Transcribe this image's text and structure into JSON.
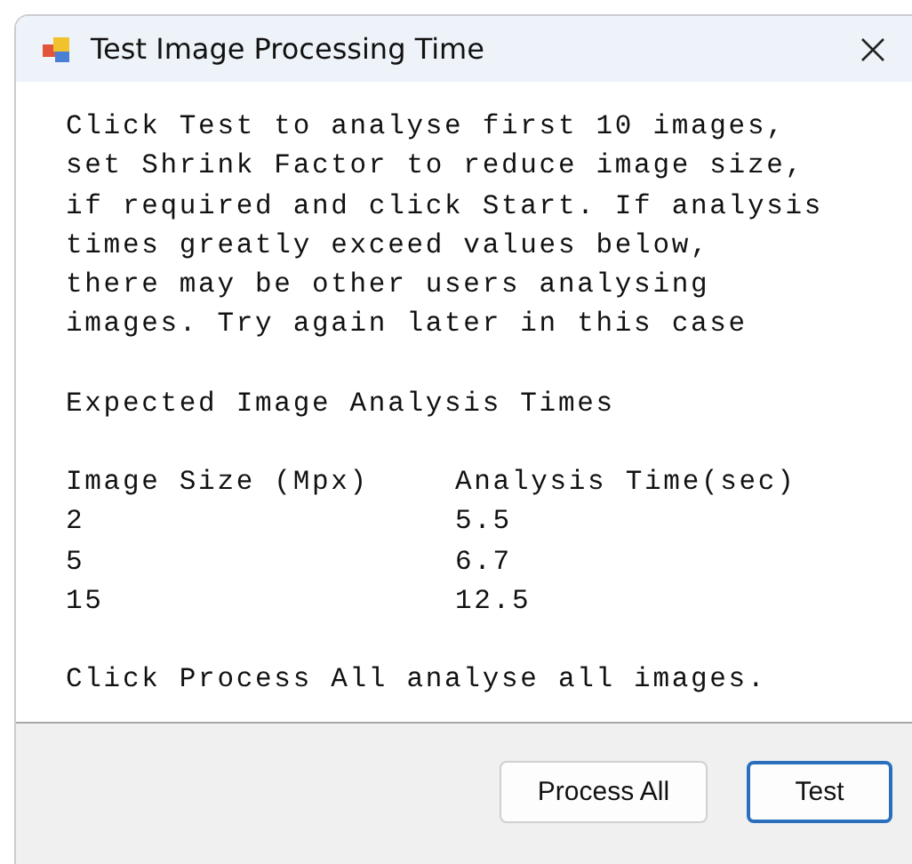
{
  "window": {
    "title": "Test Image Processing Time"
  },
  "intro": "Click Test to analyse first 10 images,\nset Shrink Factor to reduce image size,\nif required and click Start. If analysis\ntimes greatly exceed values below,\nthere may be other users analysing\nimages. Try again later in this case",
  "heading": "Expected Image Analysis Times",
  "table": {
    "columns": [
      "Image Size (Mpx)",
      "Analysis Time(sec)"
    ],
    "rows": [
      [
        "2",
        "5.5"
      ],
      [
        "5",
        "6.7"
      ],
      [
        "15",
        "12.5"
      ]
    ]
  },
  "footer_note": "Click Process All analyse all images.",
  "buttons": [
    {
      "label": "Process All",
      "default": false
    },
    {
      "label": "Test",
      "default": true
    }
  ]
}
